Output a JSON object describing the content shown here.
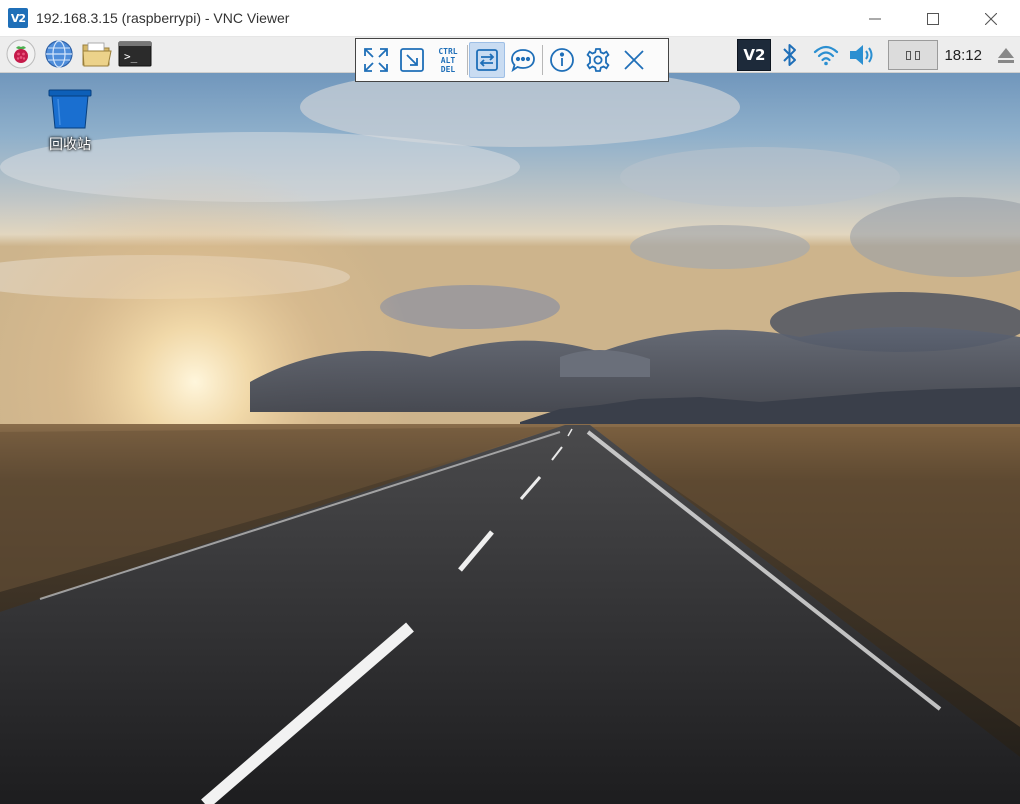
{
  "window": {
    "title": "192.168.3.15 (raspberrypi) - VNC Viewer",
    "logo_text": "V2"
  },
  "taskbar": {
    "left_icons": [
      "raspberry-menu-icon",
      "web-browser-icon",
      "file-manager-icon",
      "terminal-icon"
    ],
    "terminal_glyph": ">_",
    "tray_icons": [
      "vnc-server-icon",
      "bluetooth-icon",
      "wifi-icon",
      "volume-icon"
    ],
    "vnc_logo_text": "V2",
    "clock": "18:12",
    "eject_icon": "eject-icon"
  },
  "vnc_toolbar": {
    "buttons": [
      "fullscreen-icon",
      "scale-icon",
      "ctrl-alt-del-icon",
      "file-transfer-icon",
      "chat-icon",
      "info-icon",
      "settings-icon",
      "close-icon"
    ],
    "cad_line1": "CTRL",
    "cad_line2": "ALT",
    "cad_line3": "DEL",
    "active_button": "file-transfer-icon"
  },
  "desktop": {
    "icons": [
      {
        "label": "回收站",
        "icon": "trash-icon"
      }
    ]
  },
  "colors": {
    "accent": "#1f6fb8",
    "toolbar_active": "#c9dcf2",
    "taskbar_bg": "#ededed",
    "trash_blue": "#1a6fd0"
  }
}
